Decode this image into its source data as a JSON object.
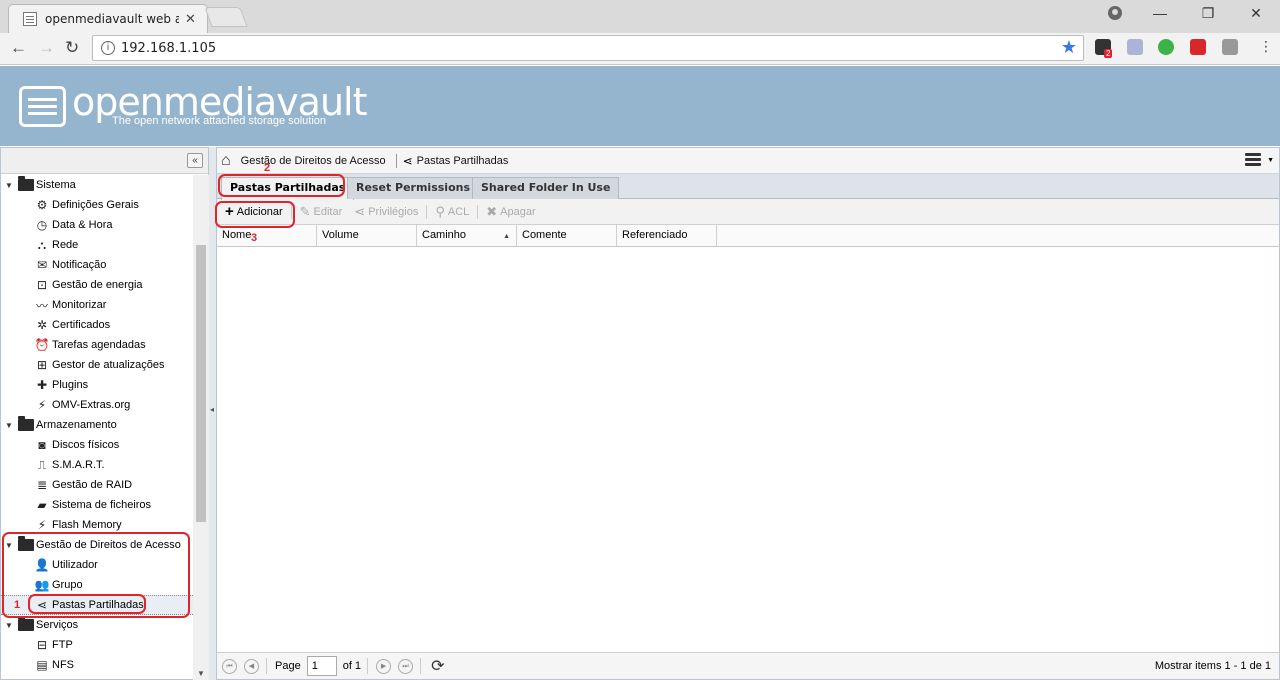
{
  "browser": {
    "tab_title": "openmediavault web adr",
    "tab_close": "✕",
    "url": "192.168.1.105",
    "window_controls": [
      "—",
      "❐",
      "✕"
    ],
    "extension_badge": "2"
  },
  "header": {
    "title": "openmediavault",
    "subtitle": "The open network attached storage solution"
  },
  "tree": {
    "groups": [
      {
        "label": "Sistema",
        "items": [
          {
            "label": "Definições Gerais",
            "icon": "gears-icon",
            "glyph": "⚙"
          },
          {
            "label": "Data & Hora",
            "icon": "clock-icon",
            "glyph": "◷"
          },
          {
            "label": "Rede",
            "icon": "network-icon",
            "glyph": "⛬"
          },
          {
            "label": "Notificação",
            "icon": "envelope-icon",
            "glyph": "✉"
          },
          {
            "label": "Gestão de energia",
            "icon": "power-icon",
            "glyph": "⊡"
          },
          {
            "label": "Monitorizar",
            "icon": "chart-line-icon",
            "glyph": "〰"
          },
          {
            "label": "Certificados",
            "icon": "certificate-icon",
            "glyph": "✲"
          },
          {
            "label": "Tarefas agendadas",
            "icon": "alarm-clock-icon",
            "glyph": "⏰"
          },
          {
            "label": "Gestor de atualizações",
            "icon": "update-icon",
            "glyph": "⊞"
          },
          {
            "label": "Plugins",
            "icon": "puzzle-icon",
            "glyph": "✚"
          },
          {
            "label": "OMV-Extras.org",
            "icon": "plug-icon",
            "glyph": "⚡"
          }
        ]
      },
      {
        "label": "Armazenamento",
        "items": [
          {
            "label": "Discos físicos",
            "icon": "disk-icon",
            "glyph": "◙"
          },
          {
            "label": "S.M.A.R.T.",
            "icon": "pulse-icon",
            "glyph": "⎍"
          },
          {
            "label": "Gestão de RAID",
            "icon": "database-icon",
            "glyph": "≣"
          },
          {
            "label": "Sistema de ficheiros",
            "icon": "folder-icon",
            "glyph": "▰"
          },
          {
            "label": "Flash Memory",
            "icon": "flash-icon",
            "glyph": "⚡"
          }
        ]
      },
      {
        "label": "Gestão de Direitos de Acesso",
        "items": [
          {
            "label": "Utilizador",
            "icon": "user-icon",
            "glyph": "👤"
          },
          {
            "label": "Grupo",
            "icon": "users-icon",
            "glyph": "👥"
          },
          {
            "label": "Pastas Partilhadas",
            "icon": "share-icon",
            "glyph": "⋖",
            "selected": true
          }
        ]
      },
      {
        "label": "Serviços",
        "items": [
          {
            "label": "FTP",
            "icon": "ftp-icon",
            "glyph": "⊟"
          },
          {
            "label": "NFS",
            "icon": "nfs-icon",
            "glyph": "▤"
          }
        ]
      }
    ],
    "collapse": "«"
  },
  "breadcrumb": {
    "section": "Gestão de Direitos de Acesso",
    "page": "Pastas Partilhadas"
  },
  "tabs": [
    "Pastas Partilhadas",
    "Reset Permissions",
    "Shared Folder In Use"
  ],
  "toolbar": {
    "add": "Adicionar",
    "edit": "Editar",
    "privileges": "Privilégios",
    "acl": "ACL",
    "delete": "Apagar"
  },
  "grid": {
    "columns": [
      "Nome",
      "Volume",
      "Caminho",
      "Comente",
      "Referenciado"
    ]
  },
  "pager": {
    "page_label": "Page",
    "page_value": "1",
    "of_label": "of 1",
    "display": "Mostrar items 1 - 1 de 1"
  },
  "annotations": [
    "1",
    "2",
    "3"
  ],
  "colors": {
    "header_bg": "#95b4cd",
    "annotation": "#e0242b"
  }
}
